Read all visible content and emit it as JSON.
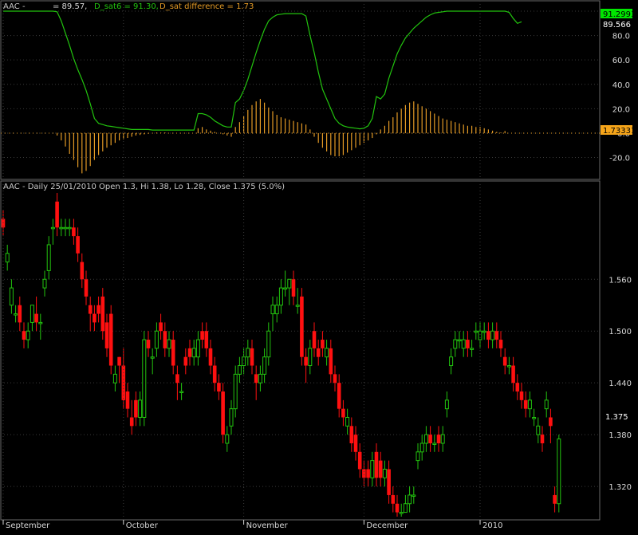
{
  "colors": {
    "background": "#000000",
    "grid": "#3a3a3a",
    "border": "#6a6a6a",
    "sat_line": "#22c40e",
    "diff_bars": "#e39a25",
    "candle_up": "#22c40e",
    "candle_down": "#ff1010",
    "axis_text": "#d8d8d8",
    "last_value_green_bg": "#00e600",
    "last_value_orange_bg": "#f6a51a"
  },
  "chart_data": [
    {
      "type": "line",
      "panel": "indicator",
      "title_prefix": "AAC -",
      "legend": [
        {
          "text": "= 89.57,"
        },
        {
          "text": "D_sat6 = 91.30,"
        },
        {
          "text": "D_sat difference = 1.73"
        }
      ],
      "ylim": [
        -36,
        100
      ],
      "y_ticks": [
        "100.0",
        "80.0",
        "60.0",
        "40.0",
        "20.0",
        "0.0",
        "-20.0"
      ],
      "y_tick_values": [
        100,
        80,
        60,
        40,
        20,
        0,
        -20
      ],
      "last_values": {
        "sat6": "91.2993",
        "sat": "89.566",
        "difference": "1.73331"
      },
      "series": [
        {
          "values": [
            100,
            100,
            100,
            100,
            100,
            100,
            100,
            100,
            100,
            100,
            100,
            100,
            100,
            99.5,
            92,
            82,
            72,
            61,
            52,
            44,
            35,
            24,
            12,
            8,
            7,
            6,
            5.5,
            5,
            4.5,
            4,
            3.5,
            3,
            3,
            3,
            3,
            3,
            2.5,
            2.5,
            2.5,
            2.5,
            2.5,
            2.5,
            2.5,
            2.5,
            2.5,
            2.5,
            2.5,
            16,
            16,
            15,
            13,
            10,
            8,
            6,
            5,
            5,
            25,
            28,
            35,
            44,
            55,
            66,
            76,
            85,
            92,
            95,
            97,
            97.5,
            98,
            98,
            98,
            98,
            98,
            96,
            80,
            66,
            50,
            36,
            28,
            20,
            12,
            8,
            6,
            5,
            4.5,
            4,
            3.5,
            4,
            6,
            12,
            30,
            28,
            32,
            45,
            55,
            65,
            72,
            78,
            82,
            86,
            89,
            92,
            95,
            97,
            98.5,
            99,
            99.5,
            100,
            100,
            100,
            100,
            100,
            100,
            100,
            100,
            100,
            100,
            100,
            100,
            100,
            100,
            100,
            99,
            94,
            90,
            91.3
          ]
        },
        {
          "values": [
            0,
            0,
            0,
            0,
            0,
            0,
            0,
            0,
            0,
            0,
            0,
            0,
            0,
            -2,
            -6,
            -11,
            -17,
            -22,
            -28,
            -33,
            -31,
            -27,
            -22,
            -18,
            -15,
            -12,
            -10,
            -8,
            -6,
            -5,
            -4,
            -3,
            -2,
            -1.5,
            -1,
            -0.5,
            0,
            0.5,
            0.5,
            0.5,
            0,
            0,
            0,
            0,
            0,
            0,
            0,
            4,
            5,
            3,
            2,
            1,
            0,
            -1,
            -2,
            -3,
            5,
            9,
            14,
            19,
            23,
            26,
            28,
            25,
            21,
            18,
            15,
            13,
            12,
            11,
            10,
            9,
            8,
            7,
            3,
            -3,
            -8,
            -12,
            -15,
            -18,
            -19,
            -19,
            -18,
            -16,
            -14,
            -12,
            -10,
            -8,
            -6,
            -4,
            -1,
            3,
            6,
            10,
            13,
            17,
            20,
            23,
            25,
            26,
            24,
            22,
            20,
            18,
            16,
            14,
            12,
            11,
            10,
            9,
            8,
            7,
            6,
            6,
            5,
            5,
            4,
            3,
            2,
            1,
            0.5,
            1.73
          ]
        }
      ]
    },
    {
      "type": "candlestick",
      "panel": "price",
      "title": "AAC - Daily 25/01/2010 Open 1.3, Hi 1.38, Lo 1.28, Close 1.375 (5.0%)",
      "ylim": [
        1.285,
        1.66
      ],
      "y_ticks": [
        "1.560",
        "1.500",
        "1.440",
        "1.380",
        "1.320"
      ],
      "y_tick_values": [
        1.56,
        1.5,
        1.44,
        1.38,
        1.32
      ],
      "last_value": "1.375",
      "x_labels": [
        "September",
        "October",
        "November",
        "December",
        "2010"
      ],
      "x_label_index": [
        0,
        29,
        58,
        87,
        115
      ],
      "candles": {
        "open": [
          1.63,
          1.58,
          1.53,
          1.52,
          1.53,
          1.5,
          1.49,
          1.51,
          1.52,
          1.51,
          1.55,
          1.57,
          1.62,
          1.65,
          1.62,
          1.62,
          1.62,
          1.62,
          1.61,
          1.58,
          1.56,
          1.53,
          1.52,
          1.53,
          1.54,
          1.51,
          1.52,
          1.44,
          1.47,
          1.46,
          1.43,
          1.4,
          1.42,
          1.4,
          1.4,
          1.49,
          1.47,
          1.48,
          1.51,
          1.5,
          1.48,
          1.49,
          1.45,
          1.43,
          1.47,
          1.48,
          1.47,
          1.47,
          1.5,
          1.5,
          1.48,
          1.46,
          1.44,
          1.43,
          1.37,
          1.39,
          1.41,
          1.45,
          1.46,
          1.47,
          1.48,
          1.45,
          1.44,
          1.45,
          1.47,
          1.52,
          1.52,
          1.53,
          1.55,
          1.55,
          1.56,
          1.53,
          1.54,
          1.47,
          1.46,
          1.5,
          1.48,
          1.49,
          1.47,
          1.48,
          1.45,
          1.44,
          1.41,
          1.39,
          1.39,
          1.38,
          1.36,
          1.34,
          1.34,
          1.33,
          1.36,
          1.35,
          1.33,
          1.34,
          1.31,
          1.3,
          1.29,
          1.29,
          1.3,
          1.31,
          1.35,
          1.36,
          1.37,
          1.38,
          1.37,
          1.38,
          1.37,
          1.41,
          1.46,
          1.48,
          1.49,
          1.48,
          1.49,
          1.48,
          1.5,
          1.49,
          1.5,
          1.5,
          1.49,
          1.5,
          1.49,
          1.47,
          1.46,
          1.46,
          1.44,
          1.43,
          1.42,
          1.41,
          1.4,
          1.38,
          1.38,
          1.41,
          1.4,
          1.31,
          1.3
        ],
        "close": [
          1.62,
          1.59,
          1.55,
          1.52,
          1.51,
          1.49,
          1.5,
          1.53,
          1.51,
          1.51,
          1.56,
          1.6,
          1.62,
          1.62,
          1.62,
          1.62,
          1.62,
          1.61,
          1.59,
          1.56,
          1.54,
          1.52,
          1.51,
          1.52,
          1.5,
          1.48,
          1.46,
          1.45,
          1.46,
          1.42,
          1.41,
          1.39,
          1.4,
          1.42,
          1.49,
          1.48,
          1.47,
          1.5,
          1.5,
          1.48,
          1.49,
          1.46,
          1.44,
          1.43,
          1.46,
          1.47,
          1.48,
          1.49,
          1.49,
          1.48,
          1.46,
          1.44,
          1.43,
          1.38,
          1.38,
          1.41,
          1.45,
          1.46,
          1.47,
          1.48,
          1.46,
          1.44,
          1.45,
          1.47,
          1.5,
          1.53,
          1.53,
          1.55,
          1.55,
          1.56,
          1.54,
          1.53,
          1.47,
          1.46,
          1.48,
          1.48,
          1.47,
          1.48,
          1.48,
          1.45,
          1.44,
          1.41,
          1.4,
          1.4,
          1.37,
          1.36,
          1.34,
          1.33,
          1.33,
          1.35,
          1.33,
          1.33,
          1.34,
          1.31,
          1.3,
          1.29,
          1.29,
          1.3,
          1.31,
          1.31,
          1.36,
          1.37,
          1.38,
          1.37,
          1.37,
          1.37,
          1.38,
          1.42,
          1.47,
          1.49,
          1.49,
          1.49,
          1.48,
          1.48,
          1.5,
          1.5,
          1.5,
          1.49,
          1.5,
          1.49,
          1.48,
          1.46,
          1.46,
          1.44,
          1.43,
          1.42,
          1.41,
          1.42,
          1.4,
          1.39,
          1.37,
          1.42,
          1.39,
          1.3,
          1.375
        ],
        "high": [
          1.64,
          1.6,
          1.56,
          1.53,
          1.54,
          1.51,
          1.51,
          1.53,
          1.54,
          1.52,
          1.57,
          1.61,
          1.63,
          1.66,
          1.63,
          1.63,
          1.63,
          1.63,
          1.62,
          1.59,
          1.57,
          1.54,
          1.53,
          1.54,
          1.55,
          1.52,
          1.53,
          1.46,
          1.47,
          1.48,
          1.44,
          1.42,
          1.43,
          1.43,
          1.5,
          1.5,
          1.48,
          1.51,
          1.52,
          1.51,
          1.5,
          1.5,
          1.46,
          1.44,
          1.48,
          1.49,
          1.49,
          1.5,
          1.51,
          1.51,
          1.49,
          1.47,
          1.45,
          1.44,
          1.39,
          1.42,
          1.46,
          1.47,
          1.48,
          1.49,
          1.49,
          1.46,
          1.46,
          1.48,
          1.51,
          1.54,
          1.54,
          1.56,
          1.57,
          1.56,
          1.57,
          1.55,
          1.55,
          1.48,
          1.49,
          1.51,
          1.49,
          1.5,
          1.49,
          1.49,
          1.46,
          1.45,
          1.42,
          1.41,
          1.4,
          1.39,
          1.37,
          1.35,
          1.35,
          1.36,
          1.37,
          1.36,
          1.35,
          1.35,
          1.32,
          1.31,
          1.3,
          1.31,
          1.32,
          1.32,
          1.37,
          1.38,
          1.39,
          1.39,
          1.38,
          1.39,
          1.39,
          1.43,
          1.48,
          1.5,
          1.5,
          1.5,
          1.5,
          1.49,
          1.51,
          1.51,
          1.51,
          1.51,
          1.51,
          1.51,
          1.5,
          1.48,
          1.47,
          1.47,
          1.45,
          1.44,
          1.43,
          1.43,
          1.41,
          1.4,
          1.39,
          1.43,
          1.41,
          1.32,
          1.38
        ],
        "low": [
          1.61,
          1.57,
          1.52,
          1.51,
          1.5,
          1.48,
          1.48,
          1.5,
          1.5,
          1.49,
          1.54,
          1.56,
          1.6,
          1.61,
          1.61,
          1.61,
          1.61,
          1.6,
          1.58,
          1.55,
          1.53,
          1.5,
          1.5,
          1.51,
          1.49,
          1.47,
          1.45,
          1.43,
          1.44,
          1.41,
          1.4,
          1.38,
          1.39,
          1.39,
          1.39,
          1.47,
          1.45,
          1.47,
          1.49,
          1.47,
          1.47,
          1.45,
          1.42,
          1.42,
          1.45,
          1.46,
          1.46,
          1.46,
          1.48,
          1.47,
          1.45,
          1.43,
          1.42,
          1.37,
          1.36,
          1.38,
          1.4,
          1.44,
          1.45,
          1.46,
          1.45,
          1.42,
          1.43,
          1.44,
          1.46,
          1.5,
          1.51,
          1.52,
          1.54,
          1.53,
          1.53,
          1.52,
          1.46,
          1.44,
          1.45,
          1.47,
          1.46,
          1.47,
          1.46,
          1.44,
          1.43,
          1.4,
          1.39,
          1.38,
          1.36,
          1.35,
          1.33,
          1.32,
          1.32,
          1.32,
          1.32,
          1.32,
          1.32,
          1.3,
          1.29,
          1.285,
          1.285,
          1.29,
          1.29,
          1.3,
          1.34,
          1.35,
          1.36,
          1.36,
          1.36,
          1.36,
          1.36,
          1.4,
          1.45,
          1.47,
          1.48,
          1.47,
          1.47,
          1.47,
          1.49,
          1.48,
          1.49,
          1.48,
          1.48,
          1.48,
          1.47,
          1.45,
          1.45,
          1.43,
          1.42,
          1.41,
          1.4,
          1.4,
          1.39,
          1.37,
          1.36,
          1.4,
          1.37,
          1.29,
          1.29
        ]
      }
    }
  ]
}
